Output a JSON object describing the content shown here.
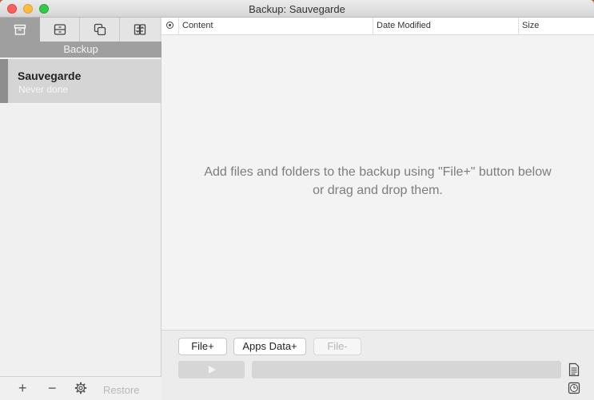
{
  "window": {
    "title": "Backup: Sauvegarde"
  },
  "sidebar": {
    "tabs": [
      {
        "icon": "archive-box-icon"
      },
      {
        "icon": "drawer-icon"
      },
      {
        "icon": "copy-icon"
      },
      {
        "icon": "sync-icon"
      }
    ],
    "section_label": "Backup",
    "items": [
      {
        "name": "Sauvegarde",
        "status": "Never done"
      }
    ],
    "bottom": {
      "add": "+",
      "remove": "−",
      "restore": "Restore"
    }
  },
  "table": {
    "columns": [
      "Content",
      "Date Modified",
      "Size"
    ]
  },
  "empty_message": {
    "line1": "Add files and folders to the backup using \"File+\" button below",
    "line2": "or drag and drop them."
  },
  "buttons": {
    "file_add": "File+",
    "apps_data": "Apps Data+",
    "file_remove": "File-"
  },
  "colors": {
    "active_tab": "#9f9f9f",
    "selected_item": "#d5d5d5"
  }
}
